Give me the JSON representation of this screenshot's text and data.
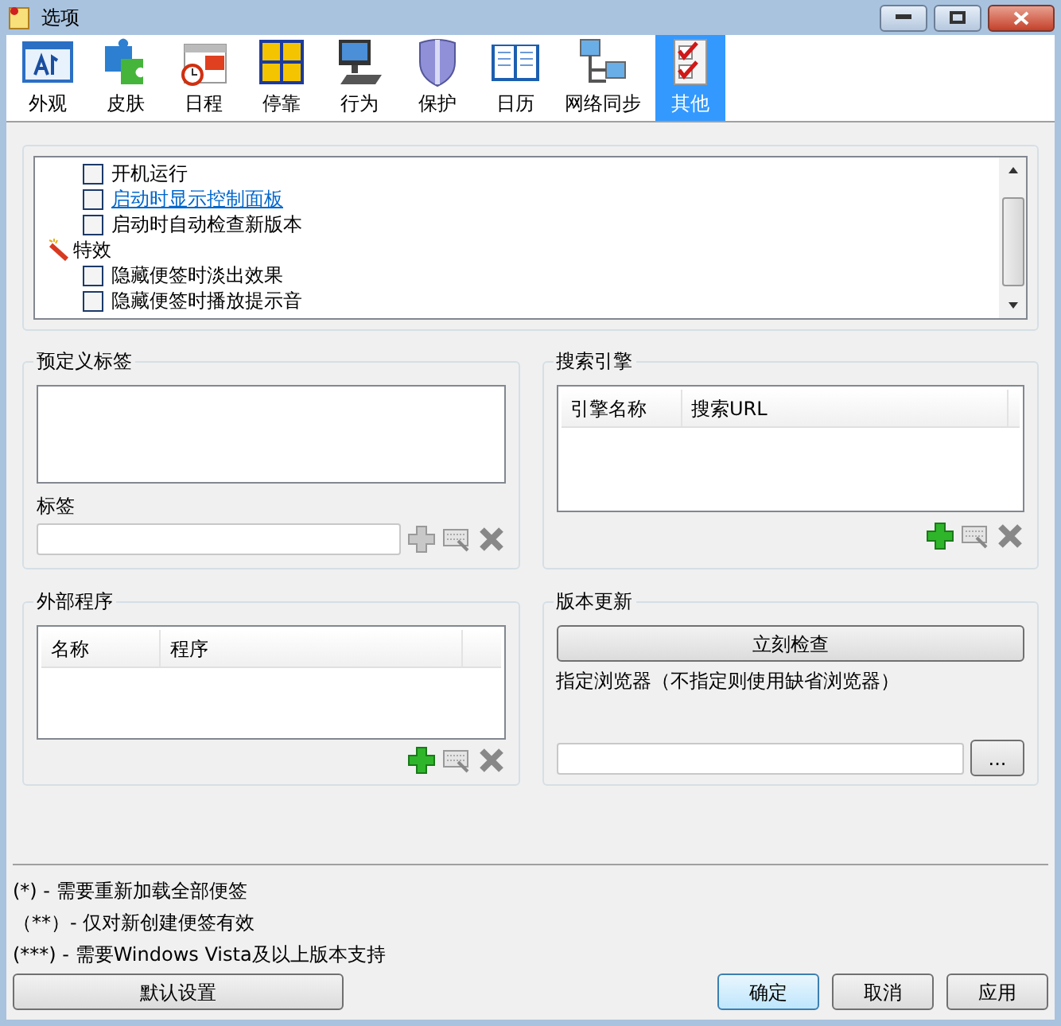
{
  "window": {
    "title": "选项"
  },
  "toolbar": [
    {
      "label": "外观",
      "kind": "appearance",
      "selected": false
    },
    {
      "label": "皮肤",
      "kind": "skin",
      "selected": false
    },
    {
      "label": "日程",
      "kind": "schedule",
      "selected": false
    },
    {
      "label": "停靠",
      "kind": "dock",
      "selected": false
    },
    {
      "label": "行为",
      "kind": "behavior",
      "selected": false
    },
    {
      "label": "保护",
      "kind": "protect",
      "selected": false
    },
    {
      "label": "日历",
      "kind": "calendar",
      "selected": false
    },
    {
      "label": "网络同步",
      "kind": "sync",
      "selected": false
    },
    {
      "label": "其他",
      "kind": "other",
      "selected": true
    }
  ],
  "options": [
    {
      "kind": "checkbox",
      "label": "开机运行",
      "checked": false,
      "link": false
    },
    {
      "kind": "checkbox",
      "label": "启动时显示控制面板",
      "checked": false,
      "link": true
    },
    {
      "kind": "checkbox",
      "label": "启动时自动检查新版本",
      "checked": false,
      "link": false
    },
    {
      "kind": "group",
      "label": "特效"
    },
    {
      "kind": "checkbox",
      "label": "隐藏便签时淡出效果",
      "checked": false,
      "link": false
    },
    {
      "kind": "checkbox",
      "label": "隐藏便签时播放提示音",
      "checked": false,
      "link": false
    }
  ],
  "predefined_tags": {
    "title": "预定义标签",
    "tag_label": "标签",
    "add_disabled": true
  },
  "search_engines": {
    "title": "搜索引擎",
    "columns": [
      "引擎名称",
      "搜索URL"
    ],
    "add_disabled": false
  },
  "external_programs": {
    "title": "外部程序",
    "columns": [
      "名称",
      "程序"
    ],
    "add_disabled": false
  },
  "update": {
    "title": "版本更新",
    "check_button": "立刻检查",
    "browser_label": "指定浏览器（不指定则使用缺省浏览器）",
    "browse_button": "..."
  },
  "notes": [
    "(*) - 需要重新加载全部便签",
    "（**）- 仅对新创建便签有效",
    "(***) - 需要Windows Vista及以上版本支持"
  ],
  "buttons": {
    "defaults": "默认设置",
    "ok": "确定",
    "cancel": "取消",
    "apply": "应用"
  }
}
